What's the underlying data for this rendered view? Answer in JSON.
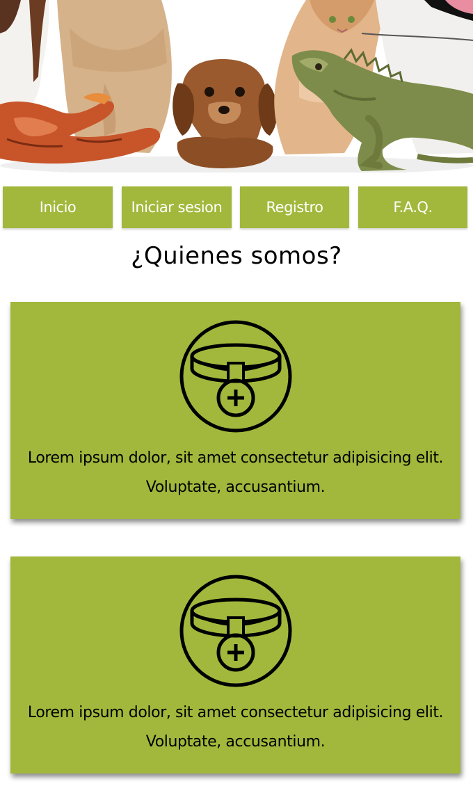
{
  "hero": {
    "image_name": "pets-banner-image"
  },
  "nav": {
    "items": [
      {
        "label": "Inicio"
      },
      {
        "label": "Iniciar sesion"
      },
      {
        "label": "Registro"
      },
      {
        "label": "F.A.Q."
      }
    ]
  },
  "main": {
    "title": "¿Quienes somos?",
    "cards": [
      {
        "icon": "pet-collar-icon",
        "text": "Lorem ipsum dolor, sit amet consectetur adipisicing elit. Voluptate, accusantium."
      },
      {
        "icon": "pet-collar-icon",
        "text": "Lorem ipsum dolor, sit amet consectetur adipisicing elit. Voluptate, accusantium."
      }
    ]
  },
  "colors": {
    "accent": "#a2b83c",
    "text_on_accent": "#ffffff",
    "text": "#000000"
  }
}
